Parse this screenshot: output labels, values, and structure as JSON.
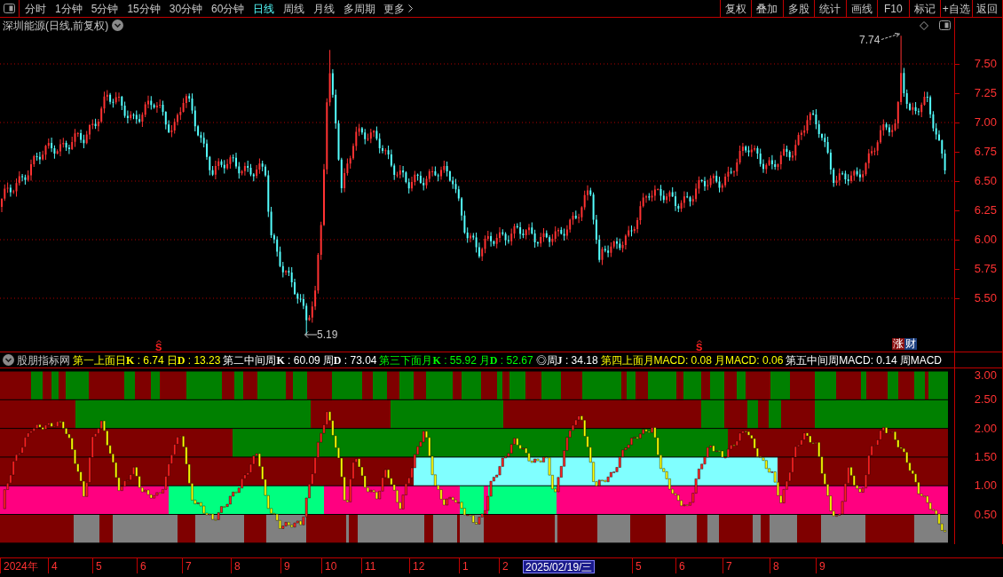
{
  "toolbar": {
    "tabs": [
      {
        "label": "分时",
        "selected": false
      },
      {
        "label": "1分钟",
        "selected": false
      },
      {
        "label": "5分钟",
        "selected": false
      },
      {
        "label": "15分钟",
        "selected": false
      },
      {
        "label": "30分钟",
        "selected": false
      },
      {
        "label": "60分钟",
        "selected": false
      },
      {
        "label": "日线",
        "selected": true
      },
      {
        "label": "周线",
        "selected": false
      },
      {
        "label": "月线",
        "selected": false
      },
      {
        "label": "多周期",
        "selected": false
      }
    ],
    "more": "更多",
    "buttons": [
      "复权",
      "叠加",
      "多股",
      "统计",
      "画线",
      "F10",
      "标记",
      "+自选",
      "返回"
    ]
  },
  "title": "深圳能源(日线,前复权)",
  "price_chart": {
    "axis_labels": [
      "7.50",
      "7.25",
      "7.00",
      "6.75",
      "6.50",
      "6.25",
      "6.00",
      "5.75",
      "5.50"
    ],
    "high_label": "7.74",
    "low_label": "5.19",
    "signals": [
      "S",
      "S"
    ],
    "tag": [
      "涨",
      "财"
    ]
  },
  "indicator": {
    "name": "股朋指标网",
    "legend": [
      {
        "text": "第一上面日**K** : 6.74",
        "color": "#ffff00"
      },
      {
        "text": "日**D** : 13.23",
        "color": "#ffff00"
      },
      {
        "text": "第二中间周**K** : 60.09",
        "color": "#ffffff"
      },
      {
        "text": "周**D** : 73.04",
        "color": "#ffffff"
      },
      {
        "text": "第三下面月**K** : 55.92",
        "color": "#00ff00"
      },
      {
        "text": "月**D** : 52.67",
        "color": "#00ff00"
      },
      {
        "text": "◎周**J** : 34.18",
        "color": "#ffffff"
      },
      {
        "text": "第四上面月MACD: 0.08",
        "color": "#ffff00"
      },
      {
        "text": "月MACD: 0.06",
        "color": "#ffff00"
      },
      {
        "text": "第五中间周MACD: 0.14",
        "color": "#ffffff"
      },
      {
        "text": "周MACD",
        "color": "#ffffff"
      }
    ],
    "axis_labels": [
      "3.00",
      "2.50",
      "2.00",
      "1.50",
      "1.00",
      "0.50"
    ]
  },
  "date_axis": {
    "labels": [
      {
        "label": "2024年",
        "kind": "tick"
      },
      {
        "label": "4",
        "kind": "tick"
      },
      {
        "label": "5",
        "kind": "tick"
      },
      {
        "label": "6",
        "kind": "tick"
      },
      {
        "label": "7",
        "kind": "tick"
      },
      {
        "label": "8",
        "kind": "tick"
      },
      {
        "label": "9",
        "kind": "tick"
      },
      {
        "label": "10",
        "kind": "tick"
      },
      {
        "label": "11",
        "kind": "tick"
      },
      {
        "label": "12",
        "kind": "tick"
      },
      {
        "label": "1",
        "kind": "tick"
      },
      {
        "label": "2",
        "kind": "tick"
      },
      {
        "label": "2025/02/19/三",
        "kind": "cursor"
      },
      {
        "label": "5",
        "kind": "tick"
      },
      {
        "label": "6",
        "kind": "tick"
      },
      {
        "label": "7",
        "kind": "tick"
      },
      {
        "label": "8",
        "kind": "tick"
      },
      {
        "label": "9",
        "kind": "tick"
      }
    ]
  }
}
